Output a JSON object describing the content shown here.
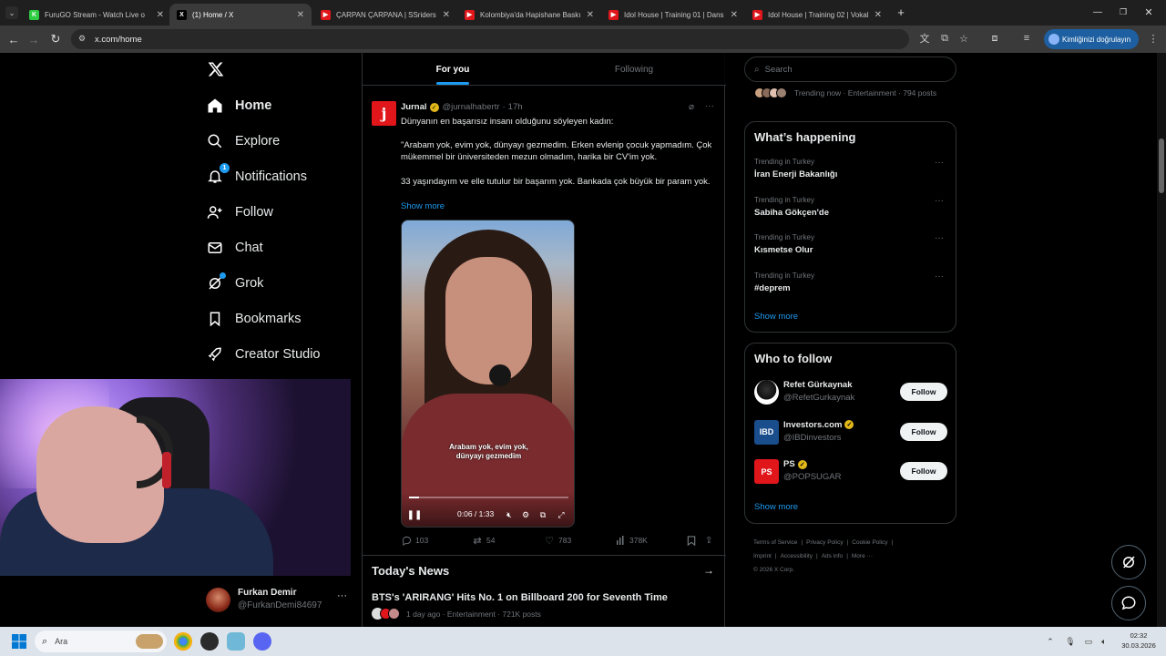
{
  "browser": {
    "tabs": [
      {
        "title": "FuruGO Stream - Watch Live o",
        "favicon_color": "#2ecc40",
        "favicon_glyph": "K",
        "active": false
      },
      {
        "title": "(1) Home / X",
        "favicon_color": "#000000",
        "favicon_glyph": "X",
        "active": true
      },
      {
        "title": "ÇARPAN ÇARPANA | SSriders |",
        "favicon_color": "#e0161b",
        "favicon_glyph": "▶",
        "active": false
      },
      {
        "title": "Kolombiya'da Hapishane Baskı",
        "favicon_color": "#e0161b",
        "favicon_glyph": "▶",
        "active": false
      },
      {
        "title": "Idol House | Training 01 | Dans",
        "favicon_color": "#e0161b",
        "favicon_glyph": "▶",
        "active": false
      },
      {
        "title": "Idol House | Training 02 | Vokal",
        "favicon_color": "#e0161b",
        "favicon_glyph": "▶",
        "active": false
      }
    ],
    "url": "x.com/home",
    "verify_button": "Kimliğinizi doğrulayın"
  },
  "nav": {
    "items": [
      {
        "label": "Home",
        "icon": "home-icon",
        "active": true
      },
      {
        "label": "Explore",
        "icon": "search-icon"
      },
      {
        "label": "Notifications",
        "icon": "bell-icon",
        "badge": "1"
      },
      {
        "label": "Follow",
        "icon": "add-person-icon"
      },
      {
        "label": "Chat",
        "icon": "mail-icon"
      },
      {
        "label": "Grok",
        "icon": "grok-icon",
        "dot": true
      },
      {
        "label": "Bookmarks",
        "icon": "bookmark-icon"
      },
      {
        "label": "Creator Studio",
        "icon": "rocket-icon"
      }
    ],
    "profile": {
      "name": "Furkan Demir",
      "handle": "@FurkanDemi84697"
    }
  },
  "feed": {
    "tabs": [
      "For you",
      "Following"
    ],
    "post": {
      "author": "Jurnal",
      "handle": "@jurnalhabertr",
      "time": "17h",
      "avatar_glyph": "j",
      "lead": "Dünyanın en başarısız insanı olduğunu söyleyen kadın:",
      "para1": "\"Arabam yok, evim yok, dünyayı gezmedim. Erken evlenip çocuk yapmadım. Çok mükemmel bir üniversiteden mezun olmadım, harika bir CV'im yok.",
      "para2": "33 yaşındayım ve elle tutulur bir başarım yok. Bankada çok büyük bir param yok.",
      "show_more": "Show more",
      "video": {
        "caption_line1": "Arabam yok, evim yok,",
        "caption_line2": "dünyayı gezmedim",
        "time": "0:06 / 1:33",
        "progress": 0.065
      },
      "replies": "103",
      "reposts": "54",
      "likes": "783",
      "views": "378K"
    },
    "news": {
      "title": "Today's News",
      "headline": "BTS's 'ARIRANG' Hits No. 1 on Billboard 200 for Seventh Time",
      "meta": "1 day ago · Entertainment · 721K posts"
    }
  },
  "sidebar": {
    "search_placeholder": "Search",
    "trending_now": "Trending now · Entertainment · 794 posts",
    "happening": {
      "title": "What’s happening",
      "trends": [
        {
          "context": "Trending in Turkey",
          "name": "İran Enerji Bakanlığı"
        },
        {
          "context": "Trending in Turkey",
          "name": "Sabiha Gökçen'de"
        },
        {
          "context": "Trending in Turkey",
          "name": "Kısmetse Olur"
        },
        {
          "context": "Trending in Turkey",
          "name": "#deprem"
        }
      ],
      "show_more": "Show more"
    },
    "who_to_follow": {
      "title": "Who to follow",
      "accounts": [
        {
          "name": "Refet Gürkaynak",
          "handle": "@RefetGurkaynak",
          "verified": false,
          "avatar_color": "#ffffff",
          "avatar_text": ""
        },
        {
          "name": "Investors.com",
          "handle": "@IBDinvestors",
          "verified": true,
          "avatar_color": "#1a4d8c",
          "avatar_text": "IBD"
        },
        {
          "name": "PS",
          "handle": "@POPSUGAR",
          "verified": true,
          "avatar_color": "#e0161b",
          "avatar_text": "PS"
        }
      ],
      "follow_label": "Follow",
      "show_more": "Show more"
    },
    "footer": {
      "links": [
        "Terms of Service",
        "Privacy Policy",
        "Cookie Policy",
        "Imprint",
        "Accessibility",
        "Ads info",
        "More ···"
      ],
      "copyright": "© 2026 X Corp."
    }
  },
  "taskbar": {
    "search_placeholder": "Ara",
    "time": "02:32",
    "date": "30.03.2026"
  }
}
